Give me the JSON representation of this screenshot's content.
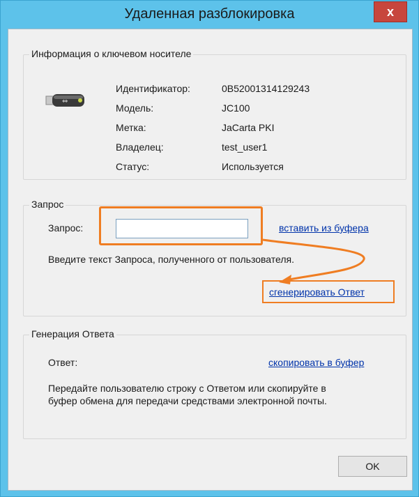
{
  "window": {
    "title": "Удаленная разблокировка",
    "close_label": "x"
  },
  "token_info": {
    "legend": "Информация о ключевом носителе",
    "icon": "usb-token-icon",
    "fields": [
      {
        "label": "Идентификатор:",
        "value": "0B52001314129243"
      },
      {
        "label": "Модель:",
        "value": "JC100"
      },
      {
        "label": "Метка:",
        "value": "JaCarta PKI"
      },
      {
        "label": "Владелец:",
        "value": "test_user1"
      },
      {
        "label": "Статус:",
        "value": "Используется"
      }
    ]
  },
  "request": {
    "legend": "Запрос",
    "label": "Запрос:",
    "value": "",
    "paste_link": "вставить из буфера",
    "hint": "Введите текст Запроса, полученного от пользователя.",
    "generate_link": "сгенерировать Ответ"
  },
  "response": {
    "legend": "Генерация Ответа",
    "label": "Ответ:",
    "copy_link": "скопировать в буфер",
    "instructions": "Передайте пользователю строку с Ответом или скопируйте в буфер обмена для передачи средствами электронной почты."
  },
  "footer": {
    "ok_label": "OK"
  },
  "colors": {
    "annotation": "#ef7d22",
    "link": "#0033aa",
    "frame": "#5dc2ea",
    "close": "#c7463d"
  }
}
